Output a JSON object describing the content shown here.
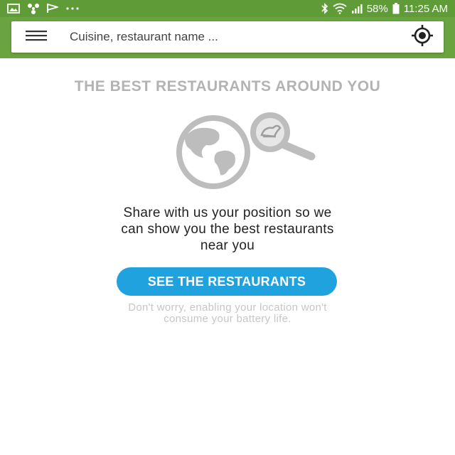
{
  "status_bar": {
    "left_icons": [
      "gallery-icon",
      "pinwheel-icon",
      "flag-icon",
      "more-dots-icon"
    ],
    "battery_percent": "58%",
    "time": "11:25 AM",
    "right_icons": [
      "bluetooth-icon",
      "wifi-icon",
      "signal-icon",
      "battery-icon"
    ]
  },
  "search": {
    "placeholder": "Cuisine, restaurant name ...",
    "menu_icon": "hamburger-menu-icon",
    "locate_icon": "gps-locate-icon"
  },
  "main": {
    "headline": "THE BEST RESTAURANTS AROUND YOU",
    "message_lines": [
      "Share with us your position so we",
      "can show you the best restaurants",
      "near you"
    ],
    "cta_label": "SEE THE RESTAURANTS",
    "note_lines": [
      "Don't worry, enabling your location won't",
      "consume your battery life."
    ]
  },
  "colors": {
    "status_bar": "#5f9c38",
    "toolbar": "#6aa441",
    "cta": "#1fa2dd",
    "headline": "#b3b3b3",
    "note": "#c6c6c6"
  }
}
